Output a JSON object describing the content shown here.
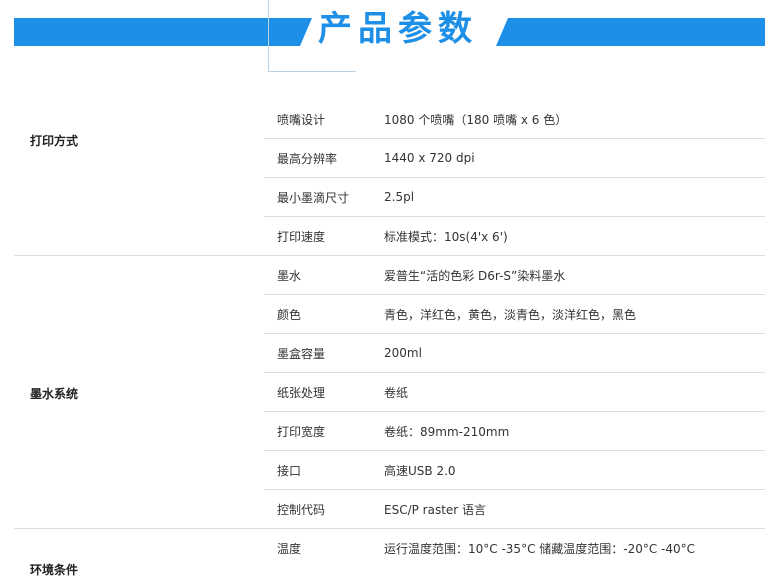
{
  "header": {
    "title": "产品参数"
  },
  "groups": [
    {
      "category": "打印方式",
      "rows": [
        {
          "label": "喷嘴设计",
          "value": "1080 个喷嘴（180 喷嘴 x 6 色）"
        },
        {
          "label": "最高分辨率",
          "value": "1440 x 720 dpi"
        },
        {
          "label": "最小墨滴尺寸",
          "value": "2.5pl"
        },
        {
          "label": "打印速度",
          "value": "标准模式：10s(4'x 6')"
        }
      ]
    },
    {
      "category": "墨水系统",
      "rows": [
        {
          "label": "墨水",
          "value": "爱普生“活的色彩 D6r-S”染料墨水"
        },
        {
          "label": "颜色",
          "value": "青色，洋红色，黄色，淡青色，淡洋红色，黑色"
        },
        {
          "label": "墨盒容量",
          "value": "200ml"
        },
        {
          "label": "纸张处理",
          "value": "卷纸"
        },
        {
          "label": "打印宽度",
          "value": "卷纸：89mm-210mm"
        },
        {
          "label": "接口",
          "value": "高速USB 2.0"
        },
        {
          "label": "控制代码",
          "value": "ESC/P raster 语言"
        }
      ]
    },
    {
      "category": "环境条件",
      "rows": [
        {
          "label": "温度",
          "value": "运行温度范围：10°C -35°C 储藏温度范围：-20°C -40°C"
        }
      ]
    }
  ]
}
